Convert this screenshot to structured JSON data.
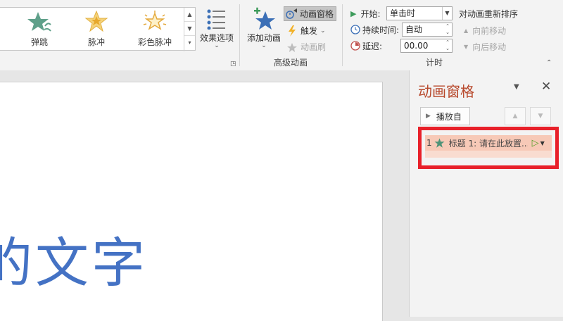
{
  "gallery": {
    "items": [
      {
        "label": "弹跳",
        "icon": "bounce-star-icon"
      },
      {
        "label": "脉冲",
        "icon": "pulse-star-icon"
      },
      {
        "label": "彩色脉冲",
        "icon": "color-pulse-star-icon"
      }
    ]
  },
  "ribbon": {
    "effect_options": "效果选项",
    "add_animation": "添加动画",
    "animation_pane": "动画窗格",
    "trigger": "触发",
    "animation_painter": "动画刷",
    "advanced_group": "高级动画",
    "timing_group": "计时",
    "start_label": "开始:",
    "start_value": "单击时",
    "duration_label": "持续时间:",
    "duration_value": "自动",
    "delay_label": "延迟:",
    "delay_value": "00.00",
    "reorder_title": "对动画重新排序",
    "move_earlier": "向前移动",
    "move_later": "向后移动"
  },
  "slide": {
    "text": "的文字"
  },
  "pane": {
    "title": "动画窗格",
    "play_from": "播放自",
    "items": [
      {
        "number": "1",
        "label": "标题 1: 请在此放置..."
      }
    ]
  },
  "colors": {
    "accent_pane_title": "#b7472a",
    "highlight_frame": "#e8202a",
    "slide_text": "#4472c4",
    "selected_item": "#f7c9b7"
  }
}
